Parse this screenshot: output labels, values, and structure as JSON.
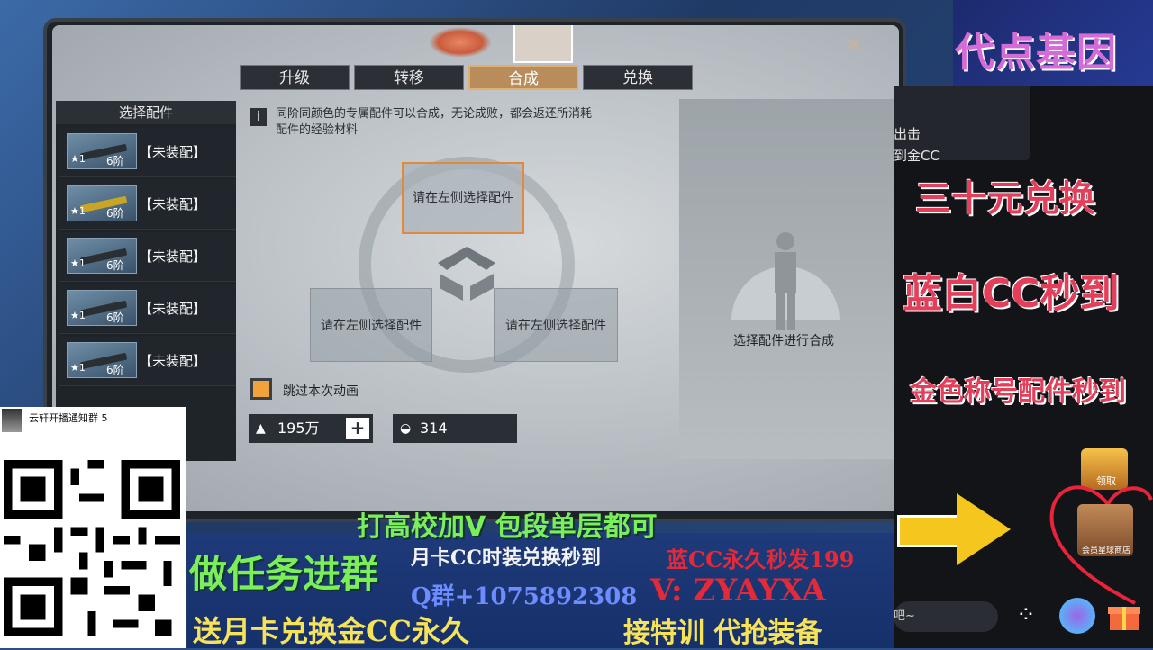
{
  "game": {
    "tabs": [
      "升级",
      "转移",
      "合成",
      "兑换"
    ],
    "active_tab": "合成",
    "sidebar_title": "选择配件",
    "items": [
      {
        "stars": "★1",
        "tier": "6阶",
        "label": "【未装配】"
      },
      {
        "stars": "★1",
        "tier": "6阶",
        "label": "【未装配】"
      },
      {
        "stars": "★1",
        "tier": "6阶",
        "label": "【未装配】"
      },
      {
        "stars": "★1",
        "tier": "6阶",
        "label": "【未装配】"
      },
      {
        "stars": "★1",
        "tier": "6阶",
        "label": "【未装配】"
      }
    ],
    "info_text": "同阶同颜色的专属配件可以合成，无论成败，都会返还所消耗配件的经验材料",
    "slot_top": "请在左侧选择配件",
    "slot_left": "请在左侧选择配件",
    "slot_right": "请在左侧选择配件",
    "skip_label": "跳过本次动画",
    "gold_value": "195万",
    "second_value": "314",
    "right_text": "选择配件进行合成",
    "close_symbol": "✕"
  },
  "stream": {
    "brand": "代点基因",
    "chat_lines": [
      "出击",
      "到金CC"
    ],
    "promo1": "三十元兑换",
    "promo2": "蓝白CC秒到",
    "promo3": "金色称号配件秒到",
    "receive_label": "领取",
    "shop_label": "会员星球商店",
    "input_placeholder": "吧~"
  },
  "overlay": {
    "line_top": "打高校加V 包段单层都可",
    "left_big": "做任务进群",
    "mid1": "月卡CC时装兑换秒到",
    "right1": "蓝CC永久秒发199",
    "qq": "Q群+1075892308",
    "vx": "V: ZYAYXA",
    "bottom_left": "送月卡兑换金CC永久",
    "bottom_right": "接特训 代抢装备"
  },
  "qr": {
    "title": "云轩开播通知群 5"
  },
  "colors": {
    "promo_red": "#e33e5a",
    "overlay_green": "#7bee5a",
    "overlay_yellow": "#f7e35a",
    "overlay_red": "#e22a3a",
    "active_tab": "#b98c5b"
  }
}
